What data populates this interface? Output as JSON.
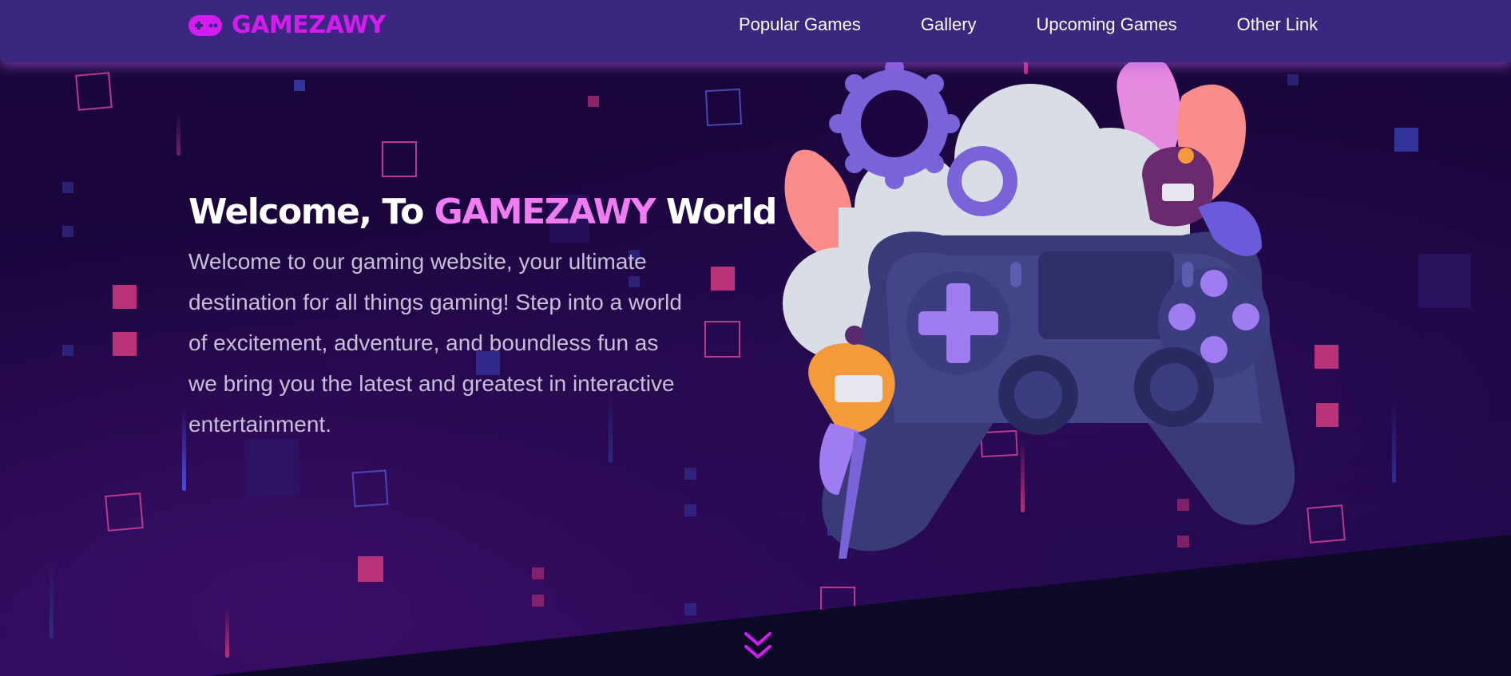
{
  "brand": {
    "name": "GAMEZAWY",
    "icon": "gamepad-icon",
    "color": "#d41cf0"
  },
  "nav": {
    "links": [
      {
        "label": "Popular Games"
      },
      {
        "label": "Gallery"
      },
      {
        "label": "Upcoming Games"
      },
      {
        "label": "Other Link"
      }
    ]
  },
  "hero": {
    "title_prefix": "Welcome, To ",
    "title_accent": "GAMEZAWY",
    "title_suffix": " World",
    "description": "Welcome to our gaming website, your ultimate destination for all things gaming! Step into a world of excitement, adventure, and boundless fun as we bring you the latest and greatest in interactive entertainment."
  },
  "scroll": {
    "icon": "double-chevron-down-icon"
  },
  "illustration": {
    "subject": "game-controller-illustration",
    "icons": [
      "gear-icon",
      "cloud-icon",
      "leaf-icon",
      "gamer-character-icon"
    ]
  },
  "colors": {
    "nav_bg": "#3b2680",
    "page_bg": "#19063a",
    "accent_pink": "#f07cf3",
    "text_muted": "#c9bed8",
    "slope": "#0c0a27"
  }
}
